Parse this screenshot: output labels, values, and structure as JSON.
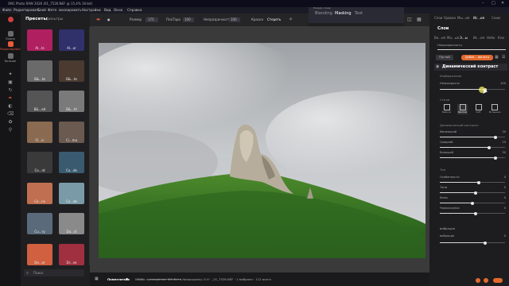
{
  "window": {
    "title": "ON1 Photo RAW 2026 (01_7526.NEF @ 15.4% 16-bit)"
  },
  "menu": [
    "Файл",
    "Редактировать",
    "Слой",
    "Фото",
    "маскировать",
    "Настройки",
    "Вид",
    "Окно",
    "Справка"
  ],
  "nav": [
    {
      "label": "Клоно",
      "icon": "browse-icon",
      "active": false
    },
    {
      "label": "Редактировать",
      "icon": "edit-icon",
      "active": true
    },
    {
      "label": "Больше",
      "icon": "more-icon",
      "active": false
    }
  ],
  "presets": {
    "title": "Пресеты",
    "tab": "фильтры",
    "search_placeholder": "Поиск",
    "items": [
      {
        "label": "AI...ts",
        "color": "#b02060"
      },
      {
        "label": "AI...or",
        "color": "#30306a"
      },
      {
        "label": "B&...te",
        "color": "#6a6a6a"
      },
      {
        "label": "B&...te",
        "color": "#4a3a30"
      },
      {
        "label": "B&...ed",
        "color": "#555555"
      },
      {
        "label": "B&...ht",
        "color": "#7a7a7a"
      },
      {
        "label": "Cl...ic",
        "color": "#8a6a50"
      },
      {
        "label": "Ci...ma",
        "color": "#6a5a50"
      },
      {
        "label": "Co...nt",
        "color": "#3a3a3a"
      },
      {
        "label": "Co...de",
        "color": "#3a5a70"
      },
      {
        "label": "Co...ns",
        "color": "#c07050"
      },
      {
        "label": "Co...de",
        "color": "#7a9aa8"
      },
      {
        "label": "Cu...ry",
        "color": "#5a6a7a"
      },
      {
        "label": "Da...st",
        "color": "#8a8a8a"
      },
      {
        "label": "De...er",
        "color": "#d06040"
      },
      {
        "label": "Dr...ve",
        "color": "#a03040"
      }
    ]
  },
  "toolbar": {
    "size_label": "Размер",
    "size_value": "175",
    "feather_label": "ПлоТаро",
    "feather_value": "100",
    "opacity_label": "Непрозрачность",
    "opacity_value": "100",
    "paint_label": "Краска",
    "erase_label": "Стереть"
  },
  "popup_tabs": {
    "header": "Поверх слоев",
    "items": [
      "Blending",
      "Masking",
      "Text"
    ],
    "active": "Masking"
  },
  "right_panel": {
    "tabs": [
      "Слои",
      "Уровни",
      "Мы...ия",
      "Ис...ия",
      "Сним"
    ],
    "top_tabs": [
      "Ва...ия",
      "Ма...ые",
      "Э...ы",
      "Ис...ия",
      "Небо",
      "Кли"
    ],
    "layers_title": "Слои",
    "opacity_label": "Непрозрачность",
    "opacity_value": "100",
    "empty_button": "Пустой",
    "add_filter_button": "Добав... фильтр",
    "filter_title": "Динамический контраст",
    "filter_subtitle": "Изображение",
    "main_slider": {
      "label": "Непрозрачно",
      "value": "100",
      "fraction": 0.7
    },
    "style_label": "Стили",
    "modes": [
      "Natural",
      "Normal",
      "Soft",
      "Вспышка"
    ],
    "active_mode": "Normal",
    "contrast_section": "Динамический контраст",
    "contrast_sliders": [
      {
        "label": "Маленький",
        "value": "30",
        "fraction": 0.85
      },
      {
        "label": "Средний",
        "value": "20",
        "fraction": 0.75
      },
      {
        "label": "Большой",
        "value": "30",
        "fraction": 0.85
      }
    ],
    "tone_section": "Тон",
    "tone_sliders": [
      {
        "label": "Особенности",
        "value": "0",
        "fraction": 0.6
      },
      {
        "label": "Тени",
        "value": "0",
        "fraction": 0.55
      },
      {
        "label": "Белы",
        "value": "0",
        "fraction": 0.5
      },
      {
        "label": "Черноскопка",
        "value": "0",
        "fraction": 0.55
      }
    ],
    "vibrance_section": "вибрация",
    "vibrance_slider": {
      "label": "вибрация",
      "value": "0",
      "fraction": 0.7
    }
  },
  "status": {
    "zoom_label": "Поместиться",
    "zoom_value": "100",
    "file": "Место нахождения: ФА Фото.Напрошанку О.Н · _01_7526.NEF · 1 выбрано · 112 всего"
  },
  "colors": {
    "accent": "#e2692d",
    "background": "#1e1e1e",
    "panel": "#1d1d20"
  }
}
